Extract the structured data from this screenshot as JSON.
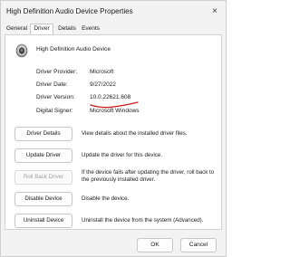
{
  "window": {
    "title": "High Definition Audio Device Properties",
    "close_glyph": "×"
  },
  "tabs": [
    {
      "label": "General",
      "active": false
    },
    {
      "label": "Driver",
      "active": true
    },
    {
      "label": "Details",
      "active": false
    },
    {
      "label": "Events",
      "active": false
    }
  ],
  "device": {
    "icon": "speaker-icon",
    "name": "High Definition Audio Device"
  },
  "properties": [
    {
      "label": "Driver Provider:",
      "value": "Microsoft"
    },
    {
      "label": "Driver Date:",
      "value": "9/27/2022"
    },
    {
      "label": "Driver Version:",
      "value": "10.0.22621.608"
    },
    {
      "label": "Digital Signer:",
      "value": "Microsoft Windows"
    }
  ],
  "actions": [
    {
      "button": "Driver Details",
      "enabled": true,
      "description": "View details about the installed driver files."
    },
    {
      "button": "Update Driver",
      "enabled": true,
      "description": "Update the driver for this device."
    },
    {
      "button": "Roll Back Driver",
      "enabled": false,
      "description": "If the device fails after updating the driver, roll back to the previously installed driver."
    },
    {
      "button": "Disable Device",
      "enabled": true,
      "description": "Disable the device."
    },
    {
      "button": "Uninstall Device",
      "enabled": true,
      "description": "Uninstall the device from the system (Advanced)."
    }
  ],
  "footer": {
    "ok_label": "OK",
    "cancel_label": "Cancel"
  },
  "colors": {
    "annotation_red": "#d11a1a",
    "disabled_text": "#9c9c9c"
  }
}
